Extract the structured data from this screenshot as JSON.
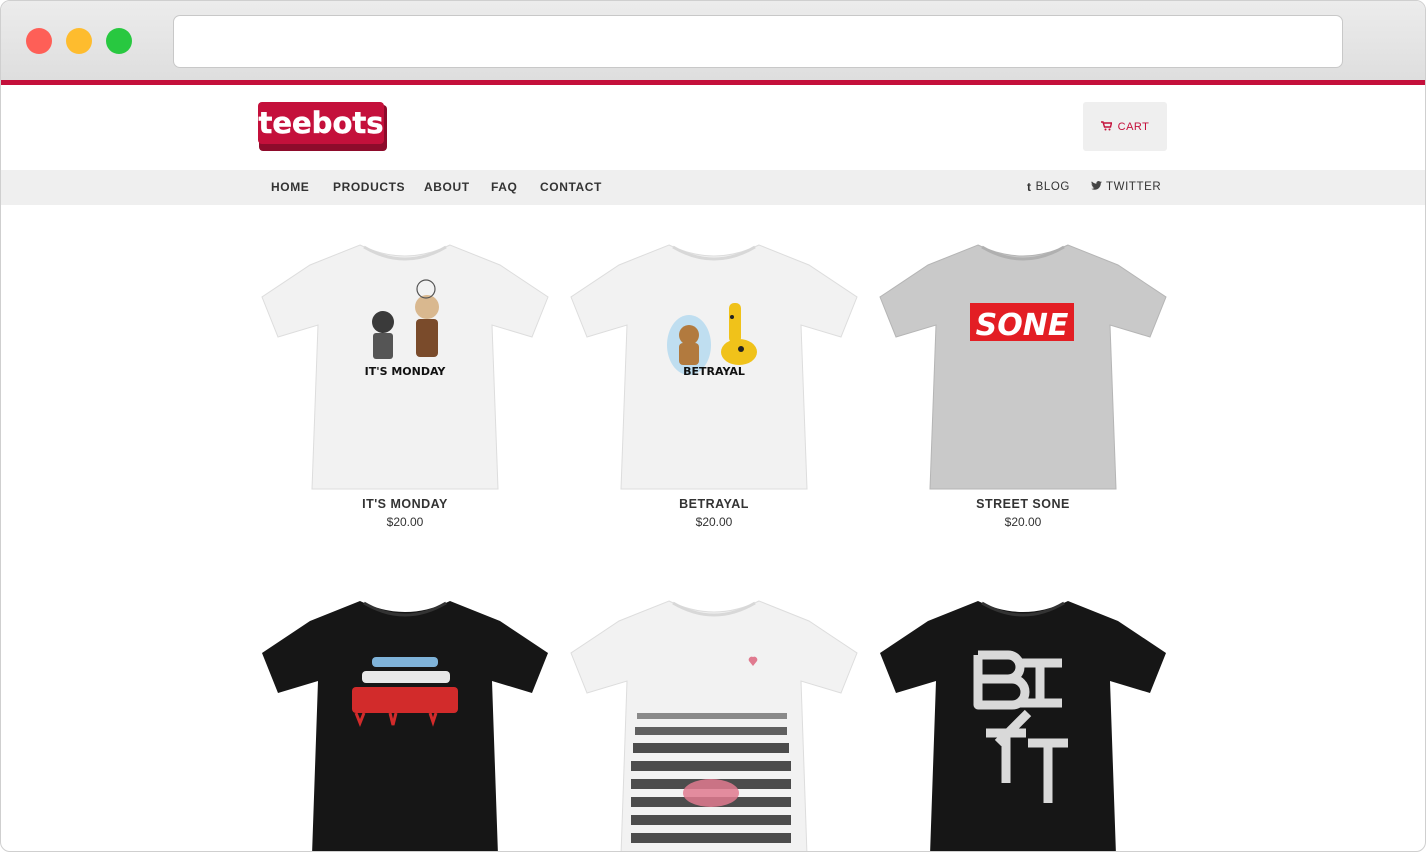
{
  "browser": {
    "url": ""
  },
  "header": {
    "logo_text": "teebots",
    "cart_label": "CART",
    "cart_icon": "shopping-cart-icon"
  },
  "nav": {
    "items": [
      "HOME",
      "PRODUCTS",
      "ABOUT",
      "FAQ",
      "CONTACT"
    ],
    "blog_label": "BLOG",
    "blog_icon": "tumblr-icon",
    "twitter_label": "TWITTER",
    "twitter_icon": "twitter-icon"
  },
  "products": [
    {
      "name": "IT'S MONDAY",
      "price": "$20.00",
      "shirt_color": "#f2f2f2",
      "graphic_text": "IT'S MONDAY"
    },
    {
      "name": "BETRAYAL",
      "price": "$20.00",
      "shirt_color": "#f2f2f2",
      "graphic_text": "BETRAYAL"
    },
    {
      "name": "STREET SONE",
      "price": "$20.00",
      "shirt_color": "#c9c9c9",
      "graphic_text": "SONE"
    },
    {
      "name": "",
      "price": "",
      "shirt_color": "#161616",
      "graphic_text": ""
    },
    {
      "name": "",
      "price": "",
      "shirt_color": "#f2f2f2",
      "graphic_text": ""
    },
    {
      "name": "",
      "price": "",
      "shirt_color": "#161616",
      "graphic_text": ""
    }
  ],
  "colors": {
    "accent": "#c4103b",
    "nav_bg": "#efefef"
  }
}
